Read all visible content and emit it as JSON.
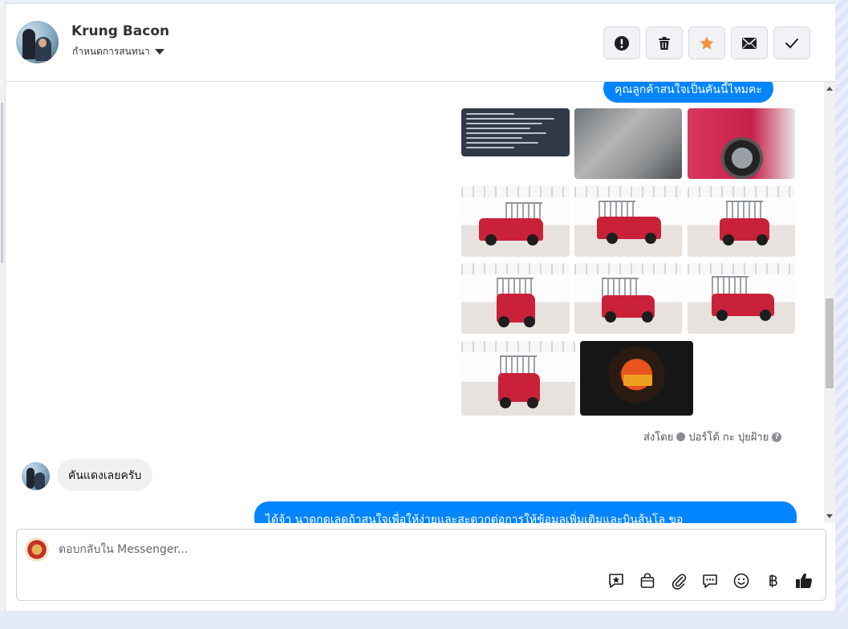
{
  "header": {
    "contact_name": "Krung Bacon",
    "assign_label": "กำหนดการสนทนา",
    "actions": [
      {
        "name": "mark-spam-button",
        "icon": "exclamation-icon"
      },
      {
        "name": "delete-button",
        "icon": "trash-icon"
      },
      {
        "name": "star-button",
        "icon": "star-icon",
        "color": "#f7923a"
      },
      {
        "name": "mark-unread-button",
        "icon": "envelope-icon"
      },
      {
        "name": "mark-done-button",
        "icon": "checkmark-icon"
      }
    ]
  },
  "chat": {
    "outgoing_top": "คุณลูกค้าสนใจเป็นคันนี้ไหมคะ",
    "sent_by_prefix": "ส่งโดย",
    "sent_by_name": "ปอร์โต้ กะ ปุยฝ้าย",
    "incoming_message": "คันแดงเลยครับ",
    "outgoing_bottom": "ได้จ้า นาดกดเลดถ้าสนใจเพื่อให้ง่ายและสะดวกต่อการให้ข้อมูลเพิ่มเติมและบินส้นโล ขอ"
  },
  "composer": {
    "placeholder": "ตอบกลับใน Messenger...",
    "tools": [
      "saved-reply-icon",
      "shop-bag-icon",
      "attachment-icon",
      "chat-bubble-icon",
      "emoji-icon",
      "baht-icon",
      "thumbs-up-icon"
    ]
  },
  "colors": {
    "accent": "#0084ff",
    "star": "#f7923a",
    "like": "#1c1e21"
  }
}
